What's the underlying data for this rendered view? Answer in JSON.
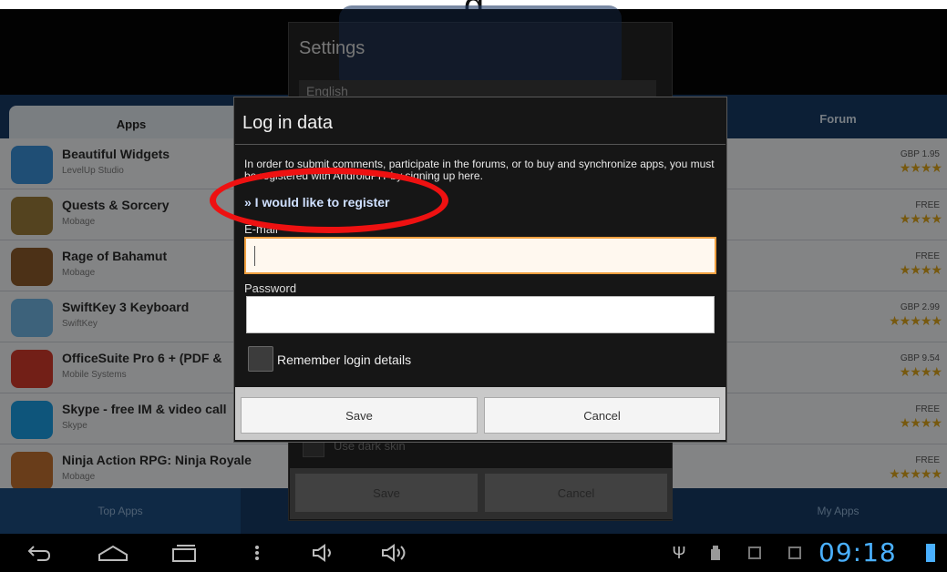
{
  "caption": "g",
  "tabs": {
    "apps": "Apps",
    "forum": "Forum",
    "top_apps": "Top Apps",
    "my_apps": "My Apps"
  },
  "apps": [
    {
      "name": "Beautiful Widgets",
      "developer": "LevelUp Studio",
      "price": "GBP 1.95",
      "stars": "★★★★",
      "icon_color": "#3a8fd6"
    },
    {
      "name": "Quests & Sorcery",
      "developer": "Mobage",
      "price": "FREE",
      "stars": "★★★★",
      "icon_color": "#9a7a3a"
    },
    {
      "name": "Rage of Bahamut",
      "developer": "Mobage",
      "price": "FREE",
      "stars": "★★★★",
      "icon_color": "#8a5a2a"
    },
    {
      "name": "SwiftKey 3 Keyboard",
      "developer": "SwiftKey",
      "price": "GBP 2.99",
      "stars": "★★★★★",
      "icon_color": "#6fb3e0"
    },
    {
      "name": "OfficeSuite Pro 6 + (PDF &",
      "developer": "Mobile Systems",
      "price": "GBP 9.54",
      "stars": "★★★★",
      "icon_color": "#d03a2a"
    },
    {
      "name": "Skype - free IM & video call",
      "developer": "Skype",
      "price": "FREE",
      "stars": "★★★★",
      "icon_color": "#1a9be0"
    },
    {
      "name": "Ninja Action RPG: Ninja Royale",
      "developer": "Mobage",
      "price": "FREE",
      "stars": "★★★★★",
      "icon_color": "#c07030"
    }
  ],
  "settings": {
    "title": "Settings",
    "language": "English",
    "dark_skin": "Use dark skin",
    "save": "Save",
    "cancel": "Cancel"
  },
  "login": {
    "title": "Log in data",
    "intro": "In order to submit comments, participate in the forums, or to buy and synchronize apps, you must be registered with AndroidPIT by signing up here.",
    "register_link": "» I would like to register",
    "email_label": "E-mail",
    "email_value": "",
    "password_label": "Password",
    "password_value": "",
    "remember_label": "Remember login details",
    "save": "Save",
    "cancel": "Cancel"
  },
  "statusbar": {
    "clock": "09:18",
    "icons": [
      "back-icon",
      "home-icon",
      "recent-apps-icon",
      "menu-icon",
      "volume-down-icon",
      "volume-up-icon",
      "usb-icon",
      "debug-icon",
      "notification-icon",
      "notification-icon-2"
    ]
  },
  "colors": {
    "accent": "#4ab0ff",
    "tabbar": "#173a63",
    "annotation": "#ee1111",
    "input_focus": "#f0a040"
  }
}
